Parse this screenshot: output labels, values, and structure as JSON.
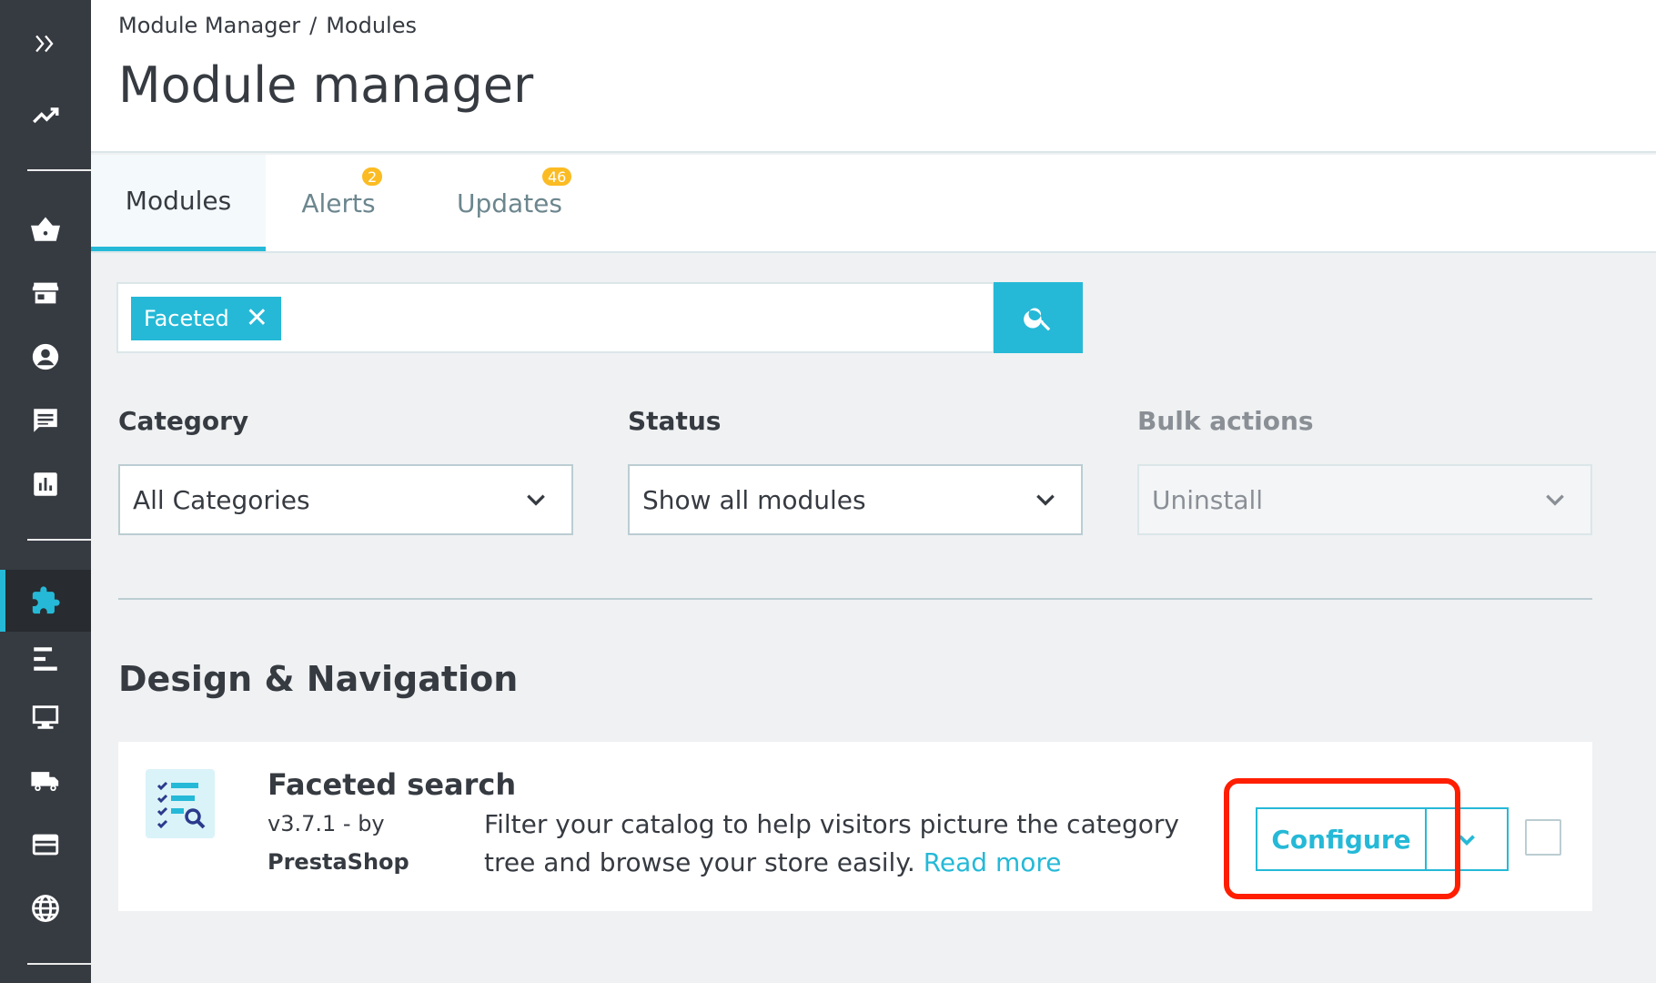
{
  "breadcrumb": {
    "parent": "Module Manager",
    "separator": "/",
    "current": "Modules"
  },
  "page_title": "Module manager",
  "tabs": [
    {
      "label": "Modules",
      "active": true
    },
    {
      "label": "Alerts",
      "badge": "2"
    },
    {
      "label": "Updates",
      "badge": "46"
    }
  ],
  "search": {
    "chip_label": "Faceted"
  },
  "filters": {
    "category": {
      "label": "Category",
      "value": "All Categories"
    },
    "status": {
      "label": "Status",
      "value": "Show all modules"
    },
    "bulk": {
      "label": "Bulk actions",
      "value": "Uninstall"
    }
  },
  "section": {
    "title": "Design & Navigation"
  },
  "module": {
    "name": "Faceted search",
    "version": "v3.7.1 - by",
    "author": "PrestaShop",
    "description": "Filter your catalog to help visitors picture the category tree and browse your store easily.",
    "read_more": "Read more",
    "configure_label": "Configure"
  },
  "colors": {
    "accent": "#25b9d7",
    "sidebar": "#363a41",
    "badge": "#fbbb22",
    "highlight": "#ff1e00"
  },
  "sidebar_icons": [
    "expand-icon",
    "trend-icon",
    "basket-icon",
    "store-icon",
    "customer-icon",
    "message-icon",
    "stats-icon",
    "puzzle-icon",
    "menu-icon",
    "monitor-icon",
    "truck-icon",
    "card-icon",
    "globe-icon"
  ]
}
